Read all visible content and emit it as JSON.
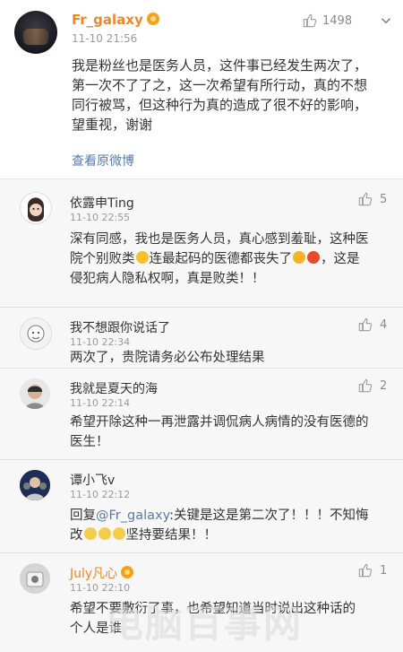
{
  "post": {
    "username": "Fr_galaxy",
    "timestamp": "11-10 21:56",
    "likes": "1498",
    "text_lines": [
      "我是粉丝也是医务人员，这件事已经发生两次了，",
      "第一次不了了之，这一次希望有所行动，真的不想",
      "同行被骂，但这种行为真的造成了很不好的影响，",
      "望重视，谢谢"
    ],
    "view_original": "查看原微博"
  },
  "replies": [
    {
      "username": "依露申Ting",
      "timestamp": "11-10 22:55",
      "likes": "5",
      "lines": [
        "深有同感，我也是医务人员，真心感到羞耻，这种医",
        "院个别败类",
        "连最起码的医德都丧失了",
        "，这是",
        "侵犯病人隐私权啊，真是败类！！"
      ]
    },
    {
      "username": "我不想跟你说话了",
      "timestamp": "11-10 22:34",
      "likes": "4",
      "lines": [
        "两次了，贵院请务必公布处理结果"
      ]
    },
    {
      "username": "我就是夏天的海",
      "timestamp": "11-10 22:14",
      "likes": "2",
      "lines": [
        "希望开除这种一再泄露并调侃病人病情的没有医德的",
        "医生！"
      ]
    },
    {
      "username": "谭小飞v",
      "timestamp": "11-10 22:12",
      "likes": "",
      "lines": [
        "回复",
        "@Fr_galaxy",
        ":关键是这是第二次了！！！不知悔",
        "改",
        "坚持要结果！！"
      ]
    },
    {
      "username": "July凡心",
      "timestamp": "11-10 22:10",
      "likes": "1",
      "lines": [
        "希望不要敷衍了事，也希望知道当时说出这种话的",
        "个人是谁"
      ]
    }
  ],
  "watermark": "电脑百事网",
  "colors": {
    "username_orange": "#e9892e",
    "link_blue": "#5a7aa7",
    "bg": "#f7f7f7",
    "vip": "#f6a11a"
  }
}
